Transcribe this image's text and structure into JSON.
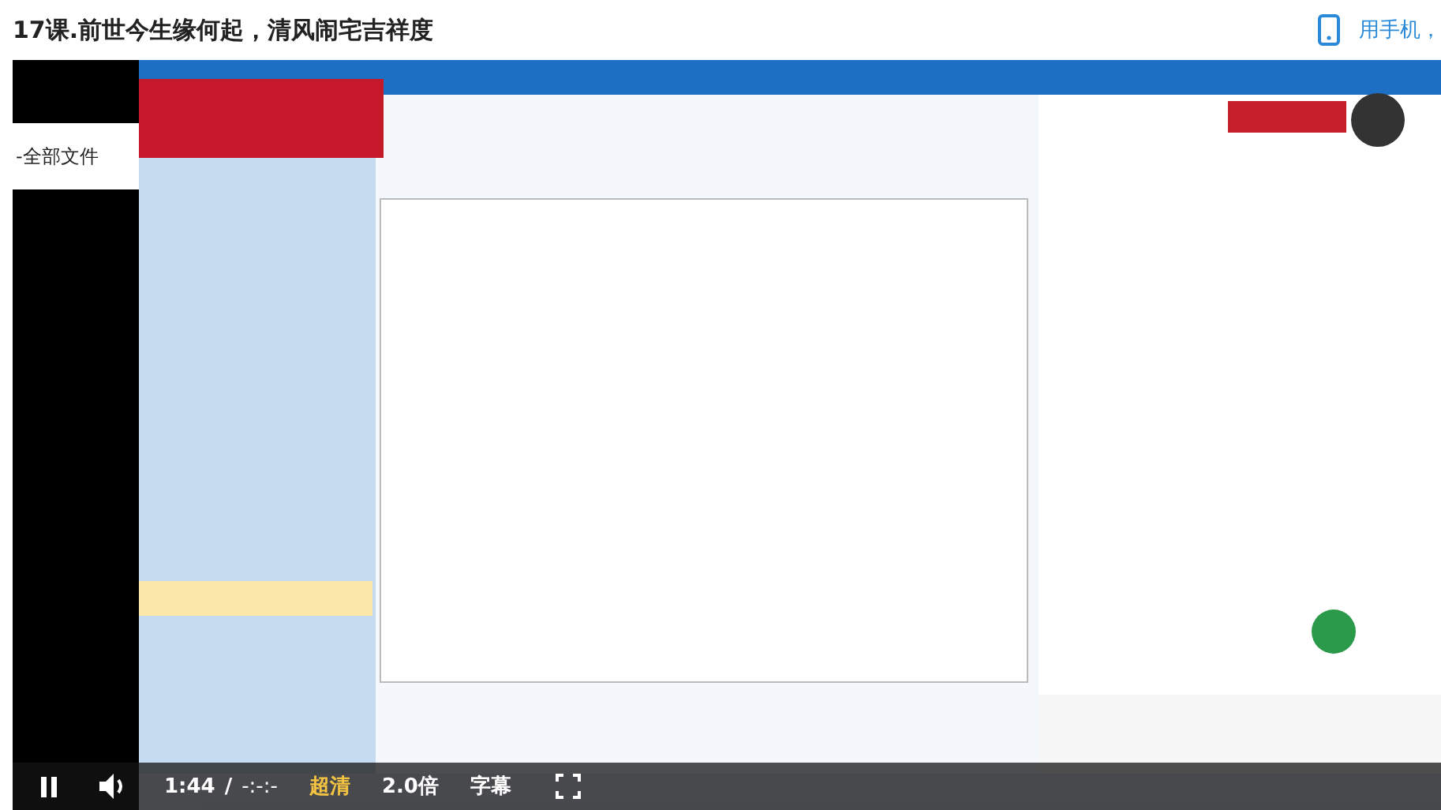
{
  "title": "17课.前世今生缘何起，清风闹宅吉祥度",
  "mobile_link": "用手机，",
  "side_panel": {
    "label": "-全部文件"
  },
  "controls": {
    "playing": true,
    "time": "1:44",
    "separator": "/",
    "duration": "-:-:-",
    "quality": "超清",
    "speed": "2.0倍",
    "subtitles": "字幕"
  }
}
